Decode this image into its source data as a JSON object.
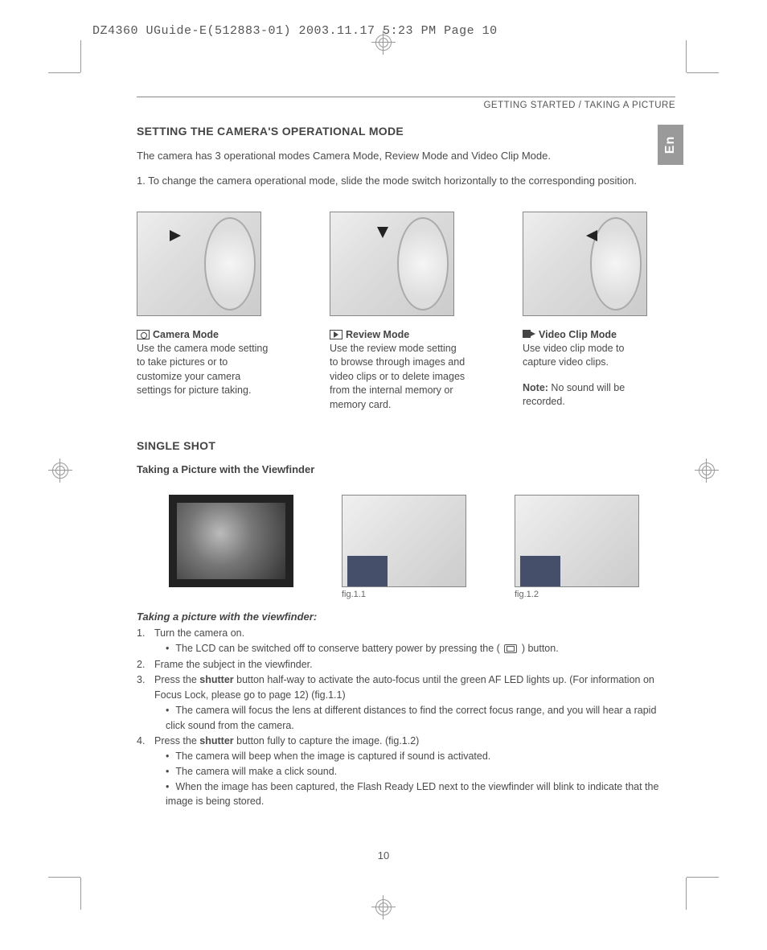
{
  "slug": "DZ4360 UGuide-E(512883-01)  2003.11.17  5:23 PM  Page 10",
  "breadcrumb": "GETTING STARTED / TAKING A PICTURE",
  "lang_tab": "En",
  "section1": {
    "title": "SETTING THE CAMERA'S OPERATIONAL MODE",
    "intro": "The camera has 3 operational modes Camera Mode, Review Mode and Video Clip Mode.",
    "step1": "1.  To change the camera operational mode, slide the mode switch horizontally to the corresponding position."
  },
  "modes": {
    "camera": {
      "title": "Camera Mode",
      "desc": "Use the camera mode setting to take pictures or to customize your camera settings for picture taking."
    },
    "review": {
      "title": "Review Mode",
      "desc": "Use the review mode setting to browse through images and video clips or to delete images from the internal memory or memory card."
    },
    "video": {
      "title": "Video Clip Mode",
      "desc": "Use video clip mode to capture video clips.",
      "note_label": "Note:",
      "note_text": "  No sound will be recorded."
    }
  },
  "section2": {
    "title": "SINGLE SHOT",
    "subtitle": "Taking a Picture with the Viewfinder",
    "fig11": "fig.1.1",
    "fig12": "fig.1.2",
    "proc_title": "Taking a picture with the viewfinder:",
    "s1": "Turn the camera on.",
    "s1b_a": "The LCD can be switched off to conserve battery power by pressing the (",
    "s1b_b": ") button.",
    "s2": "Frame the subject in the viewfinder.",
    "s3_a": "Press the ",
    "s3_b": "shutter",
    "s3_c": " button half-way to activate the auto-focus until the green AF LED lights up. (For information on Focus Lock, please go to page 12) (fig.1.1)",
    "s3b": "The camera will focus the lens at different distances to find the correct focus range, and you will hear a rapid click sound from the camera.",
    "s4_a": "Press the ",
    "s4_b": "shutter",
    "s4_c": " button fully to capture the image. (fig.1.2)",
    "s4b1": "The camera will beep when the image is captured if sound is activated.",
    "s4b2": "The camera will make a click sound.",
    "s4b3": "When the image has been captured, the Flash Ready LED next to the viewfinder will blink to indicate that the image is being stored."
  },
  "page_number": "10"
}
